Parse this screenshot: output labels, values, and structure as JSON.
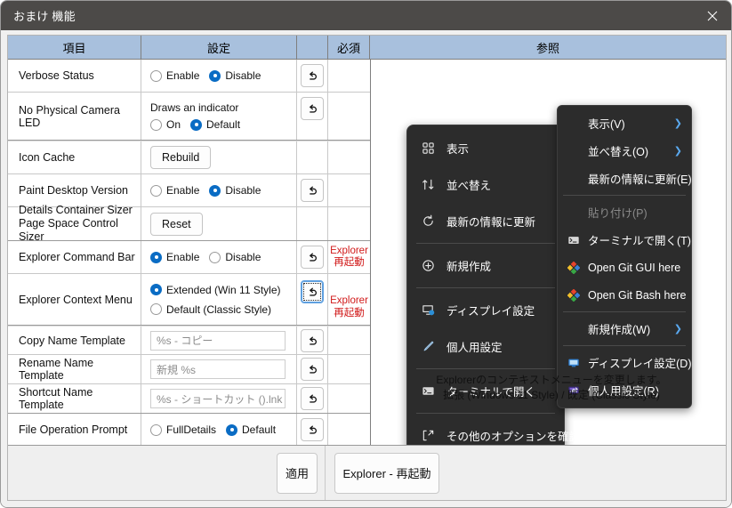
{
  "window": {
    "title": "おまけ 機能",
    "close_icon": "close-icon"
  },
  "table": {
    "headers": {
      "item": "項目",
      "setting": "設定",
      "required": "必須",
      "reference": "参照"
    },
    "rows": [
      {
        "item": "Verbose Status",
        "control": "radio",
        "options": [
          "Enable",
          "Disable"
        ],
        "selected": 1,
        "has_revert": true,
        "required_note": ""
      },
      {
        "item": "No Physical Camera LED",
        "control": "radio-with-desc",
        "description": "Draws an indicator",
        "options": [
          "On",
          "Default"
        ],
        "selected": 1,
        "has_revert": true,
        "required_note": ""
      },
      {
        "item": "Icon Cache",
        "control": "button",
        "button_label": "Rebuild",
        "has_revert": false,
        "required_note": ""
      },
      {
        "item": "Paint Desktop Version",
        "control": "radio",
        "options": [
          "Enable",
          "Disable"
        ],
        "selected": 1,
        "has_revert": true,
        "required_note": ""
      },
      {
        "item": "Details Container Sizer\nPage Space Control Sizer",
        "item_line1": "Details Container Sizer",
        "item_line2": "Page Space Control Sizer",
        "control": "button",
        "button_label": "Reset",
        "has_revert": false,
        "required_note": ""
      },
      {
        "item": "Explorer Command Bar",
        "control": "radio",
        "options": [
          "Enable",
          "Disable"
        ],
        "selected": 0,
        "has_revert": true,
        "required_note_line1": "Explorer",
        "required_note_line2": "再起動"
      },
      {
        "item": "Explorer Context Menu",
        "control": "radio-stacked",
        "options": [
          "Extended (Win 11 Style)",
          "Default (Classic Style)"
        ],
        "selected": 0,
        "has_revert": true,
        "revert_focused": true,
        "required_note_line1": "Explorer",
        "required_note_line2": "再起動"
      },
      {
        "item": "Copy Name Template",
        "control": "text",
        "placeholder": "%s - コピー",
        "value": "",
        "has_revert": true,
        "required_note": ""
      },
      {
        "item": "Rename Name Template",
        "control": "text",
        "placeholder": "新規 %s",
        "value": "",
        "has_revert": true,
        "required_note": ""
      },
      {
        "item": "Shortcut Name Template",
        "control": "text",
        "placeholder": "%s - ショートカット ().lnk",
        "value": "",
        "has_revert": true,
        "required_note": ""
      },
      {
        "item": "File Operation Prompt",
        "control": "radio",
        "options": [
          "FullDetails",
          "Default"
        ],
        "selected": 1,
        "has_revert": true,
        "required_note": ""
      }
    ]
  },
  "footer": {
    "apply_label": "適用",
    "restart_label": "Explorer - 再起動"
  },
  "preview": {
    "win11_menu": {
      "items": [
        {
          "label": "表示",
          "icon": "grid-view-icon",
          "type": "item"
        },
        {
          "label": "並べ替え",
          "icon": "sort-icon",
          "type": "item"
        },
        {
          "label": "最新の情報に更新",
          "icon": "refresh-icon",
          "type": "item"
        },
        {
          "type": "separator"
        },
        {
          "label": "新規作成",
          "icon": "plus-circle-icon",
          "type": "item"
        },
        {
          "type": "separator"
        },
        {
          "label": "ディスプレイ設定",
          "icon": "display-settings-icon",
          "type": "item"
        },
        {
          "label": "個人用設定",
          "icon": "brush-icon",
          "type": "item"
        },
        {
          "type": "separator"
        },
        {
          "label": "ターミナルで開く",
          "icon": "terminal-icon",
          "type": "item"
        },
        {
          "type": "separator"
        },
        {
          "label": "その他のオプションを確認",
          "icon": "expand-icon",
          "type": "item"
        }
      ]
    },
    "classic_menu": {
      "items": [
        {
          "label": "表示(V)",
          "accel": "V",
          "icon": "",
          "submenu": true,
          "type": "item"
        },
        {
          "label": "並べ替え(O)",
          "accel": "O",
          "icon": "",
          "submenu": true,
          "type": "item"
        },
        {
          "label": "最新の情報に更新(E)",
          "accel": "E",
          "icon": "",
          "submenu": false,
          "type": "item"
        },
        {
          "type": "separator"
        },
        {
          "label": "貼り付け(P)",
          "accel": "P",
          "icon": "",
          "submenu": false,
          "type": "item",
          "disabled": true
        },
        {
          "label": "ターミナルで開く(T)",
          "accel": "T",
          "icon": "terminal-icon",
          "submenu": false,
          "type": "item"
        },
        {
          "label": "Open Git GUI here",
          "icon": "git-icon",
          "submenu": false,
          "type": "item"
        },
        {
          "label": "Open Git Bash here",
          "icon": "git-icon",
          "submenu": false,
          "type": "item"
        },
        {
          "type": "separator"
        },
        {
          "label": "新規作成(W)",
          "accel": "W",
          "icon": "",
          "submenu": true,
          "type": "item"
        },
        {
          "type": "separator"
        },
        {
          "label": "ディスプレイ設定(D)",
          "accel": "D",
          "icon": "monitor-icon",
          "submenu": false,
          "type": "item"
        },
        {
          "label": "個人用設定(R)",
          "accel": "R",
          "icon": "personalize-icon",
          "submenu": false,
          "type": "item"
        }
      ]
    },
    "caption_line1": "Explorerのコンテキストメニューを変更します。",
    "caption_line2": "拡張 (Windows 11 Style) / 既定 (Classic Style)"
  },
  "colors": {
    "titlebar": "#4c4a48",
    "header": "#a8c0dd",
    "accent": "#0a6cc4",
    "required_red": "#d11a1a",
    "menu_bg": "#2c2c2c",
    "menu_arrow": "#5aa9ef"
  }
}
